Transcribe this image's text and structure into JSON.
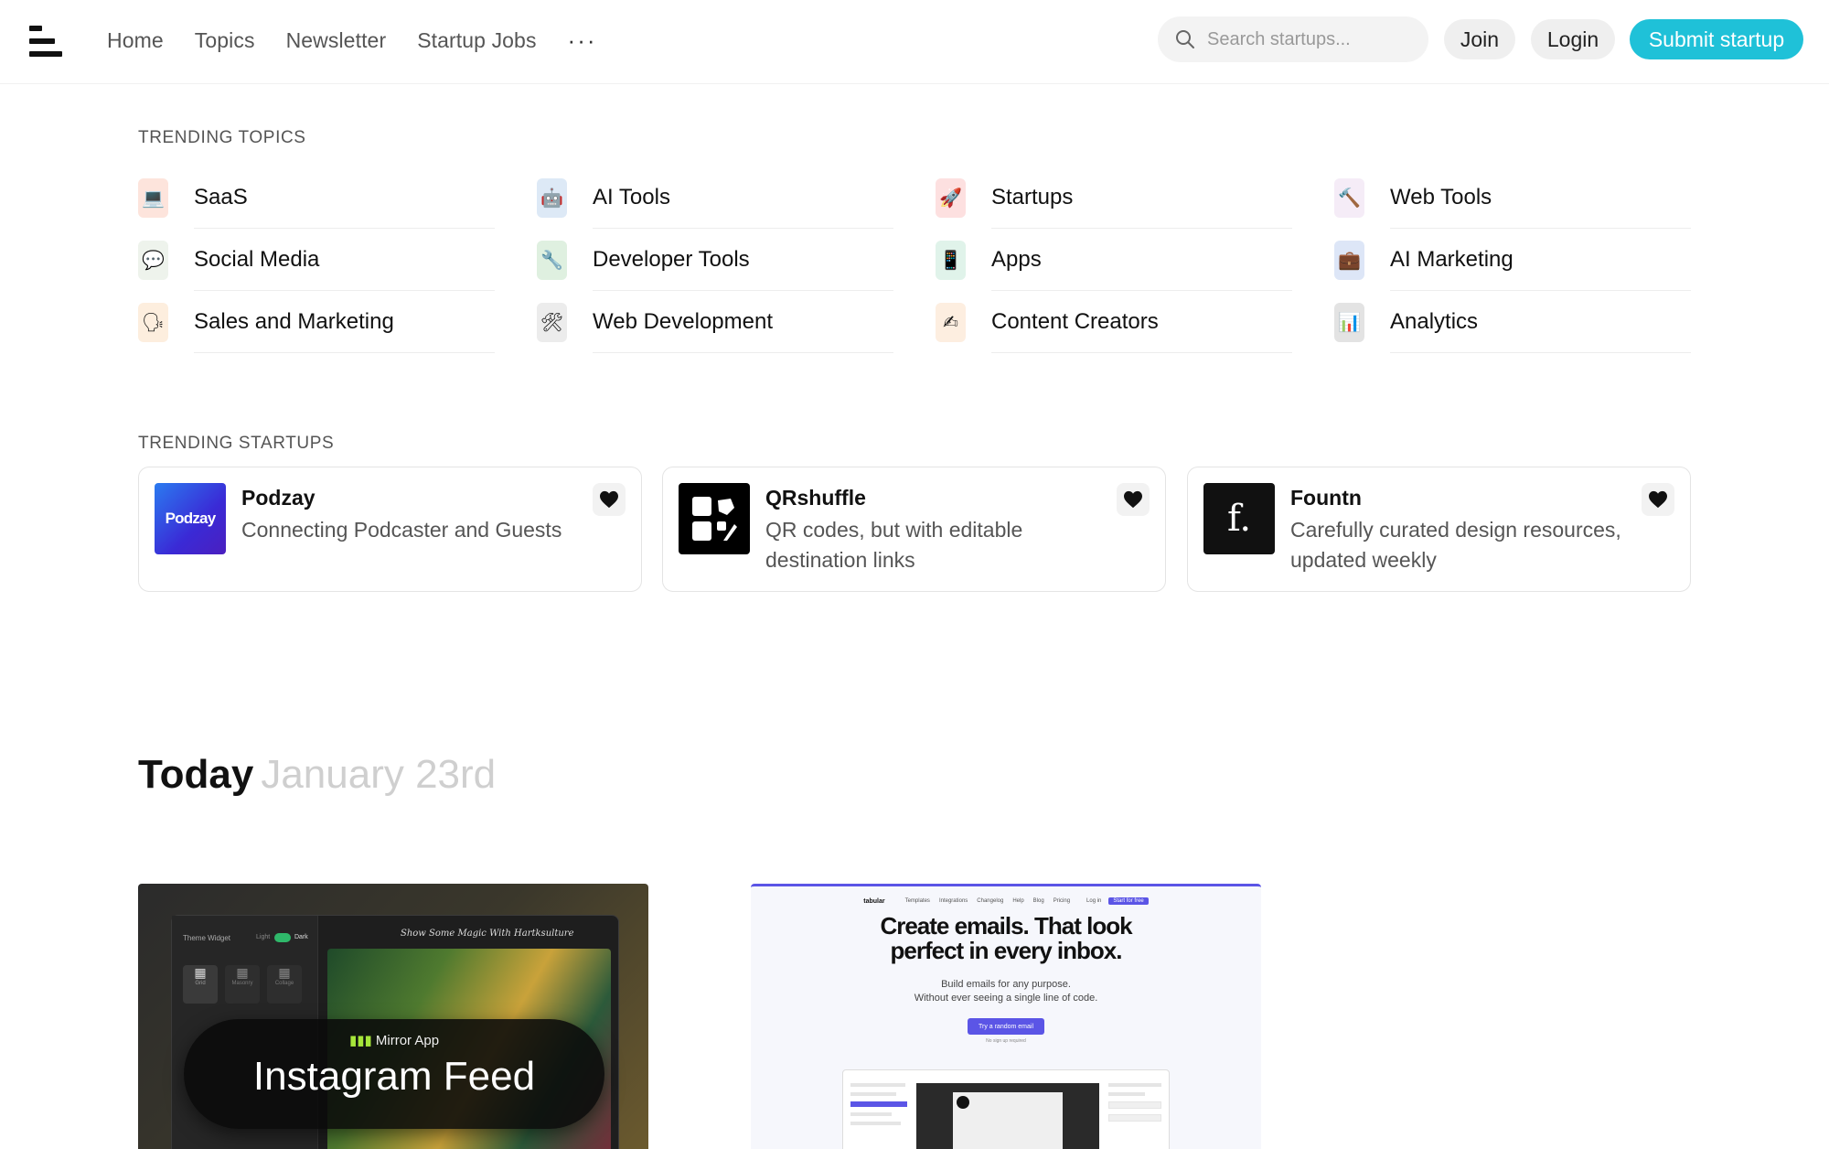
{
  "header": {
    "nav": [
      "Home",
      "Topics",
      "Newsletter",
      "Startup Jobs"
    ],
    "more": "···",
    "search_placeholder": "Search startups...",
    "join": "Join",
    "login": "Login",
    "submit": "Submit startup"
  },
  "trending_topics": {
    "label": "TRENDING TOPICS",
    "items": [
      {
        "label": "SaaS",
        "icon": "💻",
        "bg": "#fde4dc"
      },
      {
        "label": "AI Tools",
        "icon": "🤖",
        "bg": "#dde9f6"
      },
      {
        "label": "Startups",
        "icon": "🚀",
        "bg": "#fde0e0"
      },
      {
        "label": "Web Tools",
        "icon": "🔨",
        "bg": "#f5ecf7"
      },
      {
        "label": "Social Media",
        "icon": "💬",
        "bg": "#eef3ec"
      },
      {
        "label": "Developer Tools",
        "icon": "🔧",
        "bg": "#dff0e0"
      },
      {
        "label": "Apps",
        "icon": "📱",
        "bg": "#e0f3ea"
      },
      {
        "label": "AI Marketing",
        "icon": "💼",
        "bg": "#dde6f7"
      },
      {
        "label": "Sales and Marketing",
        "icon": "🗣",
        "bg": "#fdeede"
      },
      {
        "label": "Web Development",
        "icon": "🛠",
        "bg": "#ececec"
      },
      {
        "label": "Content Creators",
        "icon": "✍",
        "bg": "#fdeee0"
      },
      {
        "label": "Analytics",
        "icon": "📊",
        "bg": "#e3e3e3"
      }
    ]
  },
  "trending_startups": {
    "label": "TRENDING STARTUPS",
    "items": [
      {
        "name": "Podzay",
        "desc": "Connecting Podcaster and Guests",
        "logo_text": "Podzay"
      },
      {
        "name": "QRshuffle",
        "desc": "QR codes, but with editable destination links",
        "logo_text": ""
      },
      {
        "name": "Fountn",
        "desc": "Carefully curated design resources, updated weekly",
        "logo_text": "f."
      }
    ]
  },
  "today": {
    "title": "Today",
    "date": "January 23rd"
  },
  "feed": {
    "card1": {
      "headline": "Show Some Magic With Hartksulture",
      "widget_title": "Theme Widget",
      "light": "Light",
      "dark": "Dark",
      "tiles": [
        "Grid",
        "Masonry",
        "Collage"
      ],
      "badge": "Mirror App",
      "title": "Instagram Feed"
    },
    "card2": {
      "brand": "tabular",
      "nav": [
        "Templates",
        "Integrations",
        "Changelog",
        "Help",
        "Blog",
        "Pricing",
        "Log in"
      ],
      "cta_top": "Start for free",
      "headline1": "Create emails. That look",
      "headline2": "perfect in every inbox.",
      "sub1": "Build emails for any purpose.",
      "sub2": "Without ever seeing a single line of code.",
      "button": "Try a random email",
      "note": "No sign up required"
    }
  }
}
